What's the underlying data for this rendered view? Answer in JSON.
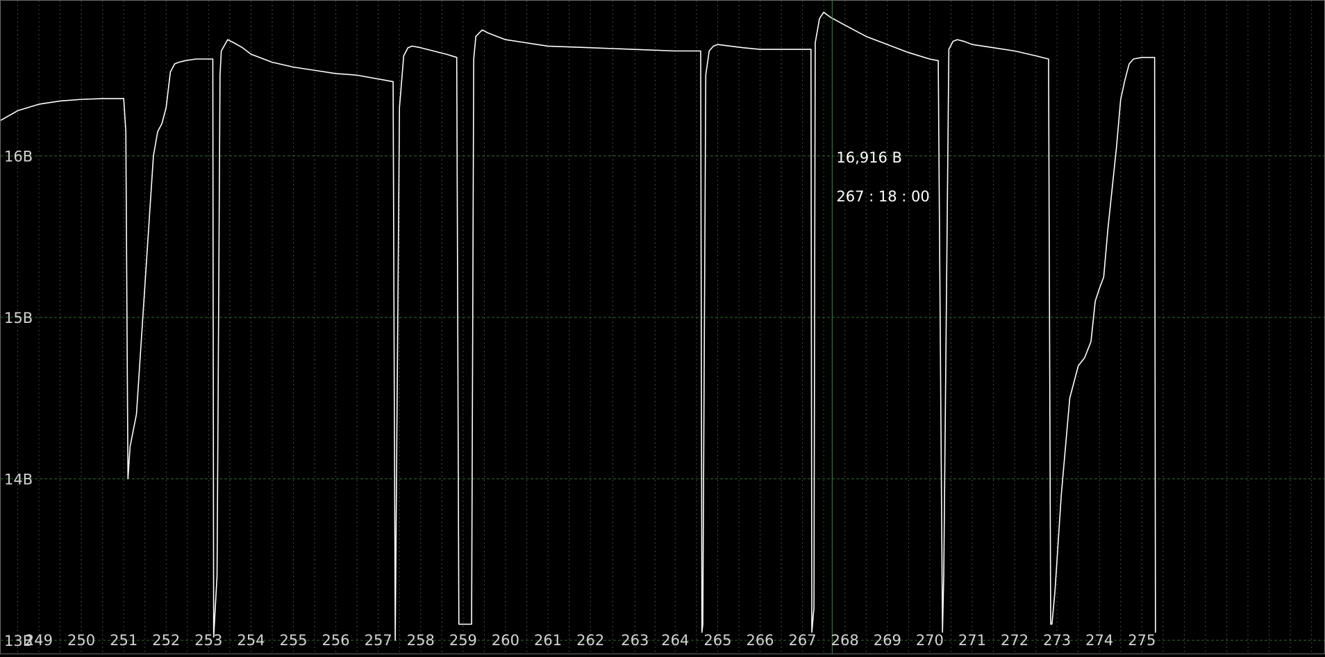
{
  "chart_data": {
    "type": "line",
    "title": "",
    "xlabel": "",
    "ylabel": "",
    "ylim": [
      13,
      17
    ],
    "xlim": [
      248.1,
      279.3
    ],
    "y_tick_values": [
      13,
      14,
      15,
      16
    ],
    "y_tick_labels": [
      "13B",
      "14B",
      "15B",
      "16B"
    ],
    "x_tick_labels": [
      "249",
      "250",
      "251",
      "252",
      "253",
      "254",
      "255",
      "256",
      "257",
      "258",
      "259",
      "260",
      "261",
      "262",
      "263",
      "264",
      "265",
      "266",
      "267",
      "268",
      "269",
      "270",
      "271",
      "272",
      "273",
      "274",
      "275"
    ],
    "x_tick_positions": [
      249,
      250,
      251,
      252,
      253,
      254,
      255,
      256,
      257,
      258,
      259,
      260,
      261,
      262,
      263.05,
      264,
      265,
      266,
      267,
      268,
      269,
      270,
      271,
      272,
      273,
      274,
      275
    ],
    "grid": {
      "horizontal": true,
      "vertical": true
    },
    "colors": {
      "background": "#000000",
      "line": "#ffffff",
      "grid": "#2f6b2f",
      "cursor": "#3b8a3b",
      "text": "#d4d4d4"
    },
    "cursor": {
      "x": 267.7,
      "value_text": "16,916 B",
      "time_text": "267 : 18 : 00"
    },
    "series": [
      {
        "x": [
          248.1,
          248.5,
          249.0,
          249.5,
          250.0,
          250.5,
          251.0,
          251.05,
          251.1,
          251.15,
          251.3,
          251.45,
          251.6,
          251.7,
          251.8,
          251.9,
          252.0,
          252.1,
          252.2,
          252.3,
          252.45,
          252.7,
          253.1,
          253.12,
          253.2,
          253.27,
          253.3,
          253.45,
          253.6,
          253.8,
          254.0,
          254.5,
          255.0,
          255.5,
          256.0,
          256.5,
          257.35,
          257.4,
          257.5,
          257.6,
          257.7,
          257.8,
          258.0,
          258.3,
          258.6,
          258.85,
          258.9,
          259.2,
          259.25,
          259.3,
          259.45,
          259.6,
          259.8,
          260.0,
          260.5,
          261.0,
          262.0,
          263.0,
          264.0,
          264.6,
          264.63,
          264.65,
          264.72,
          264.8,
          264.9,
          265.0,
          265.3,
          265.6,
          266.0,
          266.5,
          267.2,
          267.22,
          267.27,
          267.3,
          267.4,
          267.5,
          267.65,
          268.0,
          268.5,
          269.0,
          269.5,
          270.0,
          270.2,
          270.3,
          270.33,
          270.45,
          270.55,
          270.65,
          270.8,
          271.0,
          271.5,
          272.0,
          272.5,
          272.8,
          272.85,
          272.88,
          272.95,
          273.0,
          273.1,
          273.2,
          273.3,
          273.5,
          273.65,
          273.8,
          273.9,
          274.0,
          274.1,
          274.2,
          274.3,
          274.4,
          274.5,
          274.6,
          274.7,
          274.8,
          275.0,
          275.25,
          275.3,
          275.32,
          275.33
        ],
        "values": [
          16.22,
          16.28,
          16.32,
          16.34,
          16.35,
          16.355,
          16.355,
          16.15,
          14.0,
          14.2,
          14.4,
          15.0,
          15.6,
          16.0,
          16.15,
          16.2,
          16.3,
          16.52,
          16.57,
          16.58,
          16.59,
          16.6,
          16.6,
          13.02,
          13.4,
          16.5,
          16.65,
          16.72,
          16.7,
          16.67,
          16.63,
          16.58,
          16.55,
          16.53,
          16.51,
          16.5,
          16.46,
          13.0,
          16.3,
          16.62,
          16.67,
          16.68,
          16.67,
          16.65,
          16.63,
          16.61,
          13.1,
          13.1,
          16.6,
          16.74,
          16.78,
          16.76,
          16.74,
          16.72,
          16.7,
          16.68,
          16.67,
          16.66,
          16.65,
          16.65,
          13.05,
          13.1,
          16.5,
          16.65,
          16.68,
          16.69,
          16.68,
          16.67,
          16.66,
          16.66,
          16.66,
          13.05,
          13.2,
          16.7,
          16.85,
          16.89,
          16.86,
          16.81,
          16.74,
          16.69,
          16.64,
          16.6,
          16.59,
          13.05,
          13.4,
          16.66,
          16.71,
          16.72,
          16.71,
          16.69,
          16.67,
          16.65,
          16.62,
          16.6,
          13.1,
          13.1,
          13.3,
          13.5,
          13.9,
          14.2,
          14.5,
          14.7,
          14.75,
          14.85,
          15.1,
          15.18,
          15.25,
          15.55,
          15.8,
          16.05,
          16.35,
          16.47,
          16.57,
          16.6,
          16.61,
          16.61,
          16.61,
          13.05,
          13.05
        ]
      }
    ]
  }
}
